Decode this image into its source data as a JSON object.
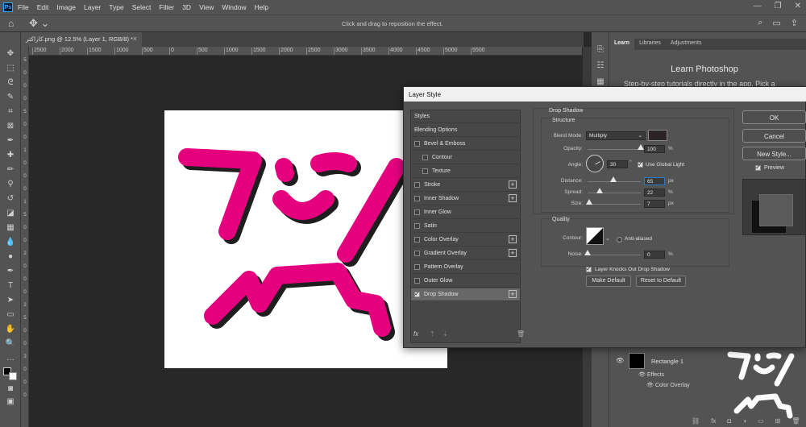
{
  "menu": [
    "File",
    "Edit",
    "Image",
    "Layer",
    "Type",
    "Select",
    "Filter",
    "3D",
    "View",
    "Window",
    "Help"
  ],
  "app_logo": "Ps",
  "options_bar": {
    "hint": "Click and drag to reposition the effect."
  },
  "document_tab": {
    "title": "کاراکتر.png @ 12.5% (Layer 1, RGB/8) *"
  },
  "ruler_top": [
    "2500",
    "2000",
    "1500",
    "1000",
    "500",
    "0",
    "500",
    "1000",
    "1500",
    "2000",
    "2500",
    "3000",
    "3500",
    "4000",
    "4500",
    "5000",
    "5500"
  ],
  "ruler_left": [
    "5",
    "0",
    "0",
    "0",
    "5",
    "0",
    "0",
    "1",
    "0",
    "0",
    "0",
    "1",
    "5",
    "0",
    "0",
    "2",
    "0",
    "0",
    "0",
    "2",
    "5",
    "0",
    "0",
    "3",
    "0",
    "0",
    "0"
  ],
  "panel_tabs": [
    "Learn",
    "Libraries",
    "Adjustments"
  ],
  "learn": {
    "title": "Learn Photoshop",
    "subtitle": "Step-by-step tutorials directly in the app. Pick a"
  },
  "layers": {
    "layer_name": "Rectangle 1",
    "effects_label": "Effects",
    "effect_item": "Color Overlay",
    "fx_badge": "fx"
  },
  "dialog": {
    "title": "Layer Style",
    "styles_header": "Styles",
    "blending_options": "Blending Options",
    "styles": [
      {
        "label": "Bevel & Emboss",
        "checked": false,
        "plus": false
      },
      {
        "label": "Contour",
        "checked": false,
        "plus": false
      },
      {
        "label": "Texture",
        "checked": false,
        "plus": false
      },
      {
        "label": "Stroke",
        "checked": false,
        "plus": true
      },
      {
        "label": "Inner Shadow",
        "checked": false,
        "plus": true
      },
      {
        "label": "Inner Glow",
        "checked": false,
        "plus": false
      },
      {
        "label": "Satin",
        "checked": false,
        "plus": false
      },
      {
        "label": "Color Overlay",
        "checked": false,
        "plus": true
      },
      {
        "label": "Gradient Overlay",
        "checked": false,
        "plus": true
      },
      {
        "label": "Pattern Overlay",
        "checked": false,
        "plus": false
      },
      {
        "label": "Outer Glow",
        "checked": false,
        "plus": false
      },
      {
        "label": "Drop Shadow",
        "checked": true,
        "plus": true
      }
    ],
    "fx": "fx",
    "section_title": "Drop Shadow",
    "structure": {
      "label": "Structure",
      "blend_mode_label": "Blend Mode:",
      "blend_mode": "Multiply",
      "shadow_color": "#2a2425",
      "opacity_label": "Opacity:",
      "opacity": "100",
      "opacity_level": 1.0,
      "angle_label": "Angle:",
      "angle": "30",
      "angle_unit": "°",
      "use_global_light": "Use Global Light",
      "use_global_light_checked": true,
      "distance_label": "Distance:",
      "distance": "65",
      "distance_level": 0.48,
      "spread_label": "Spread:",
      "spread": "22",
      "spread_level": 0.22,
      "size_label": "Size:",
      "size": "7",
      "size_level": 0.03,
      "px": "px",
      "pct": "%"
    },
    "quality": {
      "label": "Quality",
      "contour_label": "Contour:",
      "anti_aliased": "Anti-aliased",
      "noise_label": "Noise:",
      "noise": "0",
      "noise_level": 0,
      "knocks_out": "Layer Knocks Out Drop Shadow",
      "knocks_out_checked": true
    },
    "make_default": "Make Default",
    "reset_default": "Reset to Default",
    "ok": "OK",
    "cancel": "Cancel",
    "new_style": "New Style...",
    "preview": "Preview",
    "preview_checked": true
  },
  "colors": {
    "accent_magenta": "#e5007e",
    "shadow": "#1e1e1e"
  }
}
